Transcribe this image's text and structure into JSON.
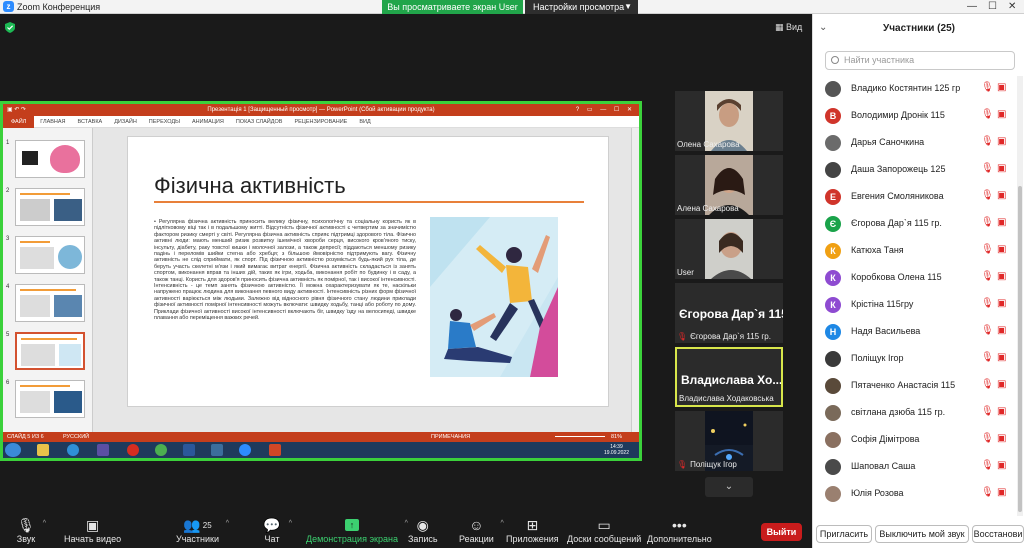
{
  "window": {
    "title": "Zoom Конференция",
    "share_banner": "Вы просматриваете экран User",
    "view_settings": "Настройки просмотра",
    "view_label": "Вид"
  },
  "ppt": {
    "title": "Презентація 1 [Защищенный просмотр] — PowerPoint (Сбой активации продукта)",
    "ribbon_tabs": [
      "ФАЙЛ",
      "ГЛАВНАЯ",
      "ВСТАВКА",
      "ДИЗАЙН",
      "ПЕРЕХОДЫ",
      "АНИМАЦИЯ",
      "ПОКАЗ СЛАЙДОВ",
      "РЕЦЕНЗИРОВАНИЕ",
      "ВИД"
    ],
    "slide_numbers": [
      "1",
      "2",
      "3",
      "4",
      "5",
      "6"
    ],
    "slide_title": "Фізична активність",
    "slide_text": "Регулярна фізична активність приносить велику фізичну, психологічну та соціальну користь як в підлітковому віці так і в подальшому житті. Відсутність фізичної активності є четвертим за значимістю фактором ризику смерті у світі. Регулярна фізична активність сприяє підтримці здорового тіла. Фізично активні люди: мають менший ризик розвитку ішемічної хвороби серця, високого кров'яного тиску, інсульту, діабету, раку товстої кишки і молочної залози, а також депресії; піддаються меншому ризику падінь і переломів шийки стегна або хребця; з більшою ймовірністю підтримують вагу. Фізичну активність не слід сприймати, як спорт. Під фізичною активністю розуміється будь-який рух тіла, де беруть участь скелетні м'язи і який вимагає витрат енергії. Фізична активність складається із занять спортом, виконання вправ та інших дій, таких як ігри, ходьба, виконання робіт по будинку і в саду, а також танці. Користь для здоров'я приносить фізична активність як помірної, так і високої інтенсивності. Інтенсивність - це темп занять фізичною активністю. Її можна охарактеризувати як те, наскільки напружено працює людина для виконання певного виду активності. Інтенсивність різних форм фізичної активності варіюється між людьми. Залежно від відносного рівня фізичного стану людини приклади фізичної активності помірної інтенсивності можуть включати: швидку ходьбу, танці або роботу по дому. Приклади фізичної активності високої інтенсивності включають біг, швидку їзду на велосипеді, швидке плавання або переміщення важких речей.",
    "status_slide": "СЛАЙД 5 ИЗ 6",
    "status_lang": "РУССКИЙ",
    "status_notes": "ПРИМЕЧАНИЯ",
    "zoom": "81%",
    "clock_time": "14:39",
    "clock_date": "19.09.2022"
  },
  "tiles": [
    {
      "name": "Олена Сахарова"
    },
    {
      "name": "Алена Сахарова"
    },
    {
      "name": "User"
    },
    {
      "name": "Єгорова Дар`я 115 гр.",
      "big": "Єгорова Дар`я 115 гр."
    },
    {
      "name": "Владислава Ходаковська",
      "big": "Владислава  Хо..."
    },
    {
      "name": "Поліщук Ігор"
    }
  ],
  "toolbar": {
    "audio": "Звук",
    "video": "Начать видео",
    "participants": "Участники",
    "participants_count": "25",
    "chat": "Чат",
    "share": "Демонстрация экрана",
    "record": "Запись",
    "reactions": "Реакции",
    "apps": "Приложения",
    "whiteboard": "Доски сообщений",
    "more": "Дополнительно",
    "leave": "Выйти"
  },
  "panel": {
    "title": "Участники (25)",
    "search_placeholder": "Найти участника",
    "participants": [
      {
        "name": "Владико Костянтин 125 гр",
        "initial": "",
        "color": "#555555"
      },
      {
        "name": "Володимир Дронік 115",
        "initial": "В",
        "color": "#d0352b"
      },
      {
        "name": "Дарья Саночкина",
        "initial": "",
        "color": "#6b6b6b"
      },
      {
        "name": "Даша Запорожець 125",
        "initial": "",
        "color": "#444444"
      },
      {
        "name": "Евгения Смоляникова",
        "initial": "Е",
        "color": "#d0352b"
      },
      {
        "name": "Єгорова Дар`я 115 гр.",
        "initial": "Є",
        "color": "#1aa34a"
      },
      {
        "name": "Катюха Таня",
        "initial": "К",
        "color": "#f0a013"
      },
      {
        "name": "Коробкова Олена 115",
        "initial": "К",
        "color": "#8e4bd1"
      },
      {
        "name": "Крістіна 115гру",
        "initial": "К",
        "color": "#8e4bd1"
      },
      {
        "name": "Надя Васильева",
        "initial": "Н",
        "color": "#1e88e5"
      },
      {
        "name": "Поліщук Ігор",
        "initial": "",
        "color": "#3a3a3a"
      },
      {
        "name": "Пятаченко Анастасія 115",
        "initial": "",
        "color": "#5a4a3a"
      },
      {
        "name": "світлана дзюба 115 гр.",
        "initial": "",
        "color": "#7a6a5a"
      },
      {
        "name": "Софія Дімітрова",
        "initial": "",
        "color": "#8a7060"
      },
      {
        "name": "Шаповал Саша",
        "initial": "",
        "color": "#4a4a4a"
      },
      {
        "name": "Юлія Розова",
        "initial": "",
        "color": "#9a8070"
      }
    ],
    "invite": "Пригласить",
    "mute_me": "Выключить мой звук",
    "restore": "Восстанови"
  }
}
